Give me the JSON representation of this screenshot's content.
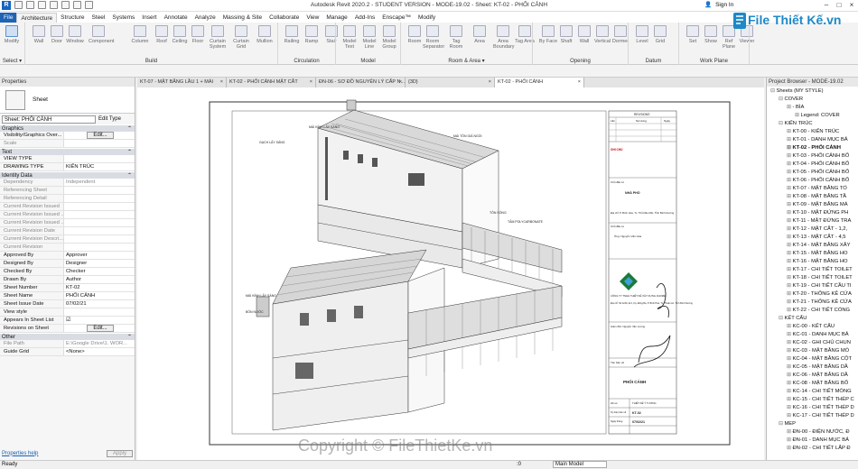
{
  "titlebar": {
    "title": "Autodesk Revit 2020.2 - STUDENT VERSION - MODE-19.02 - Sheet: KT-02 - PHỐI CẢNH",
    "sign_in": "Sign In"
  },
  "ribbon_tabs": [
    "File",
    "Architecture",
    "Structure",
    "Steel",
    "Systems",
    "Insert",
    "Annotate",
    "Analyze",
    "Massing & Site",
    "Collaborate",
    "View",
    "Manage",
    "Add-Ins",
    "Enscape™",
    "Modify"
  ],
  "ribbon_tools": [
    {
      "label": "Modify"
    },
    {
      "label": "Wall"
    },
    {
      "label": "Door"
    },
    {
      "label": "Window"
    },
    {
      "label": "Component"
    },
    {
      "label": "Column"
    },
    {
      "label": "Roof"
    },
    {
      "label": "Ceiling"
    },
    {
      "label": "Floor"
    },
    {
      "label": "Curtain System"
    },
    {
      "label": "Curtain Grid"
    },
    {
      "label": "Mullion"
    },
    {
      "label": "Railing"
    },
    {
      "label": "Ramp"
    },
    {
      "label": "Stair"
    },
    {
      "label": "Model Text"
    },
    {
      "label": "Model Line"
    },
    {
      "label": "Model Group"
    },
    {
      "label": "Room"
    },
    {
      "label": "Room Separator"
    },
    {
      "label": "Tag Room"
    },
    {
      "label": "Area"
    },
    {
      "label": "Area Boundary"
    },
    {
      "label": "Tag Area"
    },
    {
      "label": "By Face"
    },
    {
      "label": "Shaft"
    },
    {
      "label": "Wall"
    },
    {
      "label": "Vertical"
    },
    {
      "label": "Dormer"
    },
    {
      "label": "Level"
    },
    {
      "label": "Grid"
    },
    {
      "label": "Set"
    },
    {
      "label": "Show"
    },
    {
      "label": "Ref Plane"
    },
    {
      "label": "Viewer"
    }
  ],
  "ribbon_panels": [
    "Select ▾",
    "Build",
    "Circulation",
    "Model",
    "Room & Area ▾",
    "Opening",
    "Datum",
    "Work Plane"
  ],
  "doc_tabs": [
    {
      "label": "KT-07 - MẶT BẰNG LẦU 1 + MÁI",
      "active": false
    },
    {
      "label": "KT-02 - PHỐI CẢNH MẶT CẮT",
      "active": false
    },
    {
      "label": "ĐN-06 - SƠ ĐỒ NGUYÊN LÝ CẤP N...",
      "active": false
    },
    {
      "label": "{3D}",
      "active": false
    },
    {
      "label": "KT-02 - PHỐI CẢNH",
      "active": true
    }
  ],
  "properties": {
    "header": "Properties",
    "type_name": "Sheet",
    "selector": "Sheet: PHỐI CẢNH",
    "edit_type": "Edit Type",
    "groups": [
      {
        "name": "Graphics",
        "rows": [
          {
            "k": "Visibility/Graphics Over...",
            "v": "Edit...",
            "btn": true
          },
          {
            "k": "Scale",
            "v": "",
            "dim": true
          }
        ]
      },
      {
        "name": "Text",
        "rows": [
          {
            "k": "VIEW TYPE",
            "v": ""
          },
          {
            "k": "DRAWING TYPE",
            "v": "KIẾN TRÚC"
          }
        ]
      },
      {
        "name": "Identity Data",
        "rows": [
          {
            "k": "Dependency",
            "v": "Independent",
            "dim": true
          },
          {
            "k": "Referencing Sheet",
            "v": "",
            "dim": true
          },
          {
            "k": "Referencing Detail",
            "v": "",
            "dim": true
          },
          {
            "k": "Current Revision Issued",
            "v": "",
            "dim": true
          },
          {
            "k": "Current Revision Issued ...",
            "v": "",
            "dim": true
          },
          {
            "k": "Current Revision Issued ...",
            "v": "",
            "dim": true
          },
          {
            "k": "Current Revision Date",
            "v": "",
            "dim": true
          },
          {
            "k": "Current Revision Descri...",
            "v": "",
            "dim": true
          },
          {
            "k": "Current Revision",
            "v": "",
            "dim": true
          },
          {
            "k": "Approved By",
            "v": "Approver"
          },
          {
            "k": "Designed By",
            "v": "Designer"
          },
          {
            "k": "Checked By",
            "v": "Checker"
          },
          {
            "k": "Drawn By",
            "v": "Author"
          },
          {
            "k": "Sheet Number",
            "v": "KT-02"
          },
          {
            "k": "Sheet Name",
            "v": "PHỐI CẢNH"
          },
          {
            "k": "Sheet Issue Date",
            "v": "07/02/21"
          },
          {
            "k": "View style",
            "v": ""
          },
          {
            "k": "Appears In Sheet List",
            "v": "☑"
          },
          {
            "k": "Revisions on Sheet",
            "v": "Edit...",
            "btn": true
          }
        ]
      },
      {
        "name": "Other",
        "rows": [
          {
            "k": "File Path",
            "v": "E:\\Google Drive\\1. WOR...",
            "dim": true
          },
          {
            "k": "Guide Grid",
            "v": "<None>"
          }
        ]
      }
    ],
    "help": "Properties help",
    "apply": "Apply"
  },
  "browser": {
    "header": "Project Browser - MODE-19.02",
    "items": [
      {
        "t": "Sheets (MY STYLE)",
        "lvl": 0
      },
      {
        "t": "COVER",
        "lvl": 1
      },
      {
        "t": "- BÌA",
        "lvl": 2
      },
      {
        "t": "Legend: COVER",
        "lvl": 3
      },
      {
        "t": "KIẾN TRÚC",
        "lvl": 1
      },
      {
        "t": "KT-00 - KIẾN TRÚC",
        "lvl": 2
      },
      {
        "t": "KT-01 - DANH MỤC BẢ",
        "lvl": 2
      },
      {
        "t": "KT-02 - PHỐI CẢNH",
        "lvl": 2,
        "sel": true
      },
      {
        "t": "KT-03 - PHỐI CẢNH BỐ",
        "lvl": 2
      },
      {
        "t": "KT-04 - PHỐI CẢNH BỐ",
        "lvl": 2
      },
      {
        "t": "KT-05 - PHỐI CẢNH BỐ",
        "lvl": 2
      },
      {
        "t": "KT-06 - PHỐI CẢNH BỐ",
        "lvl": 2
      },
      {
        "t": "KT-07 - MẶT BẰNG TỔ",
        "lvl": 2
      },
      {
        "t": "KT-08 - MẶT BẰNG TẦ",
        "lvl": 2
      },
      {
        "t": "KT-09 - MẶT BẰNG MÁ",
        "lvl": 2
      },
      {
        "t": "KT-10 - MẶT ĐỨNG PH",
        "lvl": 2
      },
      {
        "t": "KT-11 - MẶT ĐỨNG TRA",
        "lvl": 2
      },
      {
        "t": "KT-12 - MẶT CẮT - 1,2,",
        "lvl": 2
      },
      {
        "t": "KT-13 - MẶT CẮT - 4,5",
        "lvl": 2
      },
      {
        "t": "KT-14 - MẶT BẰNG XÂY",
        "lvl": 2
      },
      {
        "t": "KT-15 - MẶT BẰNG HO",
        "lvl": 2
      },
      {
        "t": "KT-16 - MẶT BẰNG HO",
        "lvl": 2
      },
      {
        "t": "KT-17 - CHI TIẾT TOILET",
        "lvl": 2
      },
      {
        "t": "KT-18 - CHI TIẾT TOILET",
        "lvl": 2
      },
      {
        "t": "KT-19 - CHI TIẾT CẦU TI",
        "lvl": 2
      },
      {
        "t": "KT-20 - THỐNG KÊ CỬA",
        "lvl": 2
      },
      {
        "t": "KT-21 - THỐNG KÊ CỬA",
        "lvl": 2
      },
      {
        "t": "KT-22 - CHI TIẾT CỔNG",
        "lvl": 2
      },
      {
        "t": "KẾT CẤU",
        "lvl": 1
      },
      {
        "t": "KC-00 - KẾT CẤU",
        "lvl": 2
      },
      {
        "t": "KC-01 - DANH MỤC BẢ",
        "lvl": 2
      },
      {
        "t": "KC-02 - GHI CHÚ CHUN",
        "lvl": 2
      },
      {
        "t": "KC-03 - MẶT BẰNG MÓ",
        "lvl": 2
      },
      {
        "t": "KC-04 - MẶT BẰNG CỘT",
        "lvl": 2
      },
      {
        "t": "KC-05 - MẶT BẰNG DẦ",
        "lvl": 2
      },
      {
        "t": "KC-06 - MẶT BẰNG DẦ",
        "lvl": 2
      },
      {
        "t": "KC-08 - MẶT BẰNG BỐ",
        "lvl": 2
      },
      {
        "t": "KC-14 - CHI TIẾT MÓNG",
        "lvl": 2
      },
      {
        "t": "KC-15 - CHI TIẾT THÉP C",
        "lvl": 2
      },
      {
        "t": "KC-16 - CHI TIẾT THÉP D",
        "lvl": 2
      },
      {
        "t": "KC-17 - CHI TIẾT THÉP D",
        "lvl": 2
      },
      {
        "t": "MEP",
        "lvl": 1
      },
      {
        "t": "ĐN-00 - ĐIỆN NƯỚC, Đ",
        "lvl": 2
      },
      {
        "t": "ĐN-01 - DANH MỤC BẢ",
        "lvl": 2
      },
      {
        "t": "ĐN-02 - CHI TIẾT LẮP Đ",
        "lvl": 2
      }
    ]
  },
  "statusbar": {
    "ready": "Ready",
    "model": "Main Model",
    "zero": ":0"
  },
  "sheet": {
    "title_block": {
      "revisions_header": "REVISIONS",
      "rev_cols": [
        "Lần",
        "Nội dung",
        "Ngày"
      ],
      "note_red": "GHI CHÚ",
      "owner_label": "Chủ đầu tư",
      "owner": "NHÀ PHỐ",
      "address": "Địa chỉ: P. Bình Hòa, Tx. Thủ Dầu Một, Tỉnh Bình Dương",
      "client_label": "Chủ đầu tư",
      "client": "Ông: Nguyễn Văn Hòa",
      "company": "CÔNG TY TNHH THIẾT KẾ XÂY DỰNG ZHOME",
      "company_addr": "Địa chỉ: Số 12A6, Đ.2, Kp. Đông Ba, P. Bình Hòa, Tx. Thuận An, Tỉnh Bình Dương",
      "director": "Giám đốc: Nguyễn Văn Lương",
      "sheet_name_label": "Tên bản vẽ",
      "sheet_name": "PHỐI CẢNH",
      "phase_label": "Hồ sơ",
      "phase": "THIẾT KẾ Ý TƯỞNG",
      "number_label": "Ký hiệu bản vẽ",
      "number": "KT-02",
      "date_label": "Ngày tháng",
      "date": "07/02/21"
    },
    "callouts": [
      "MÁI KÍNH LẤY SÁNG",
      "MÁI TÔN GIẢ NGÓI",
      "GẠCH LẤY SÁNG",
      "TÔN SÓNG",
      "TẤM POLYCARBONATE",
      "MÁI KÍNH LẤY SÁNG",
      "BỒN NƯỚC"
    ]
  },
  "brand_logo": "File Thiết Kế.vn",
  "watermark": "Copyright © FileThietKe.vn"
}
